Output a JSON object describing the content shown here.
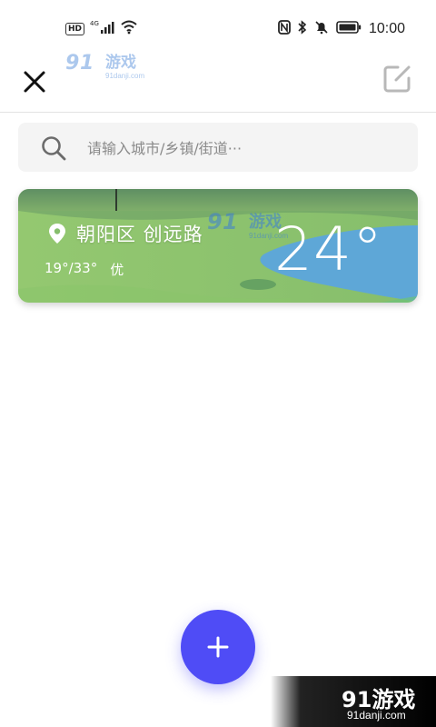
{
  "status_bar": {
    "left_badge": "HD",
    "network": "4G",
    "time": "10:00",
    "icons": [
      "hd-icon",
      "signal-icon",
      "wifi-icon",
      "nfc-icon",
      "bluetooth-icon",
      "mute-icon",
      "battery-icon"
    ]
  },
  "header": {
    "close_icon": "close-icon",
    "watermark_text": "91游戏",
    "watermark_domain": "91danji.com",
    "edit_icon": "edit-icon"
  },
  "search": {
    "placeholder": "请输入城市/乡镇/街道···",
    "value": ""
  },
  "weather_card": {
    "location": "朝阳区 创远路",
    "temp_low_high": "19°/33°",
    "air_quality": "优",
    "current_temp": "24°",
    "watermark_text": "91游戏",
    "watermark_domain": "91danji.com"
  },
  "fab": {
    "icon": "plus-icon"
  },
  "corner_brand": {
    "name": "91游戏",
    "domain": "91danji.com"
  },
  "colors": {
    "accent": "#4f4cf6",
    "card_grass": "#8cc56a",
    "card_water": "#5aa8d6"
  }
}
